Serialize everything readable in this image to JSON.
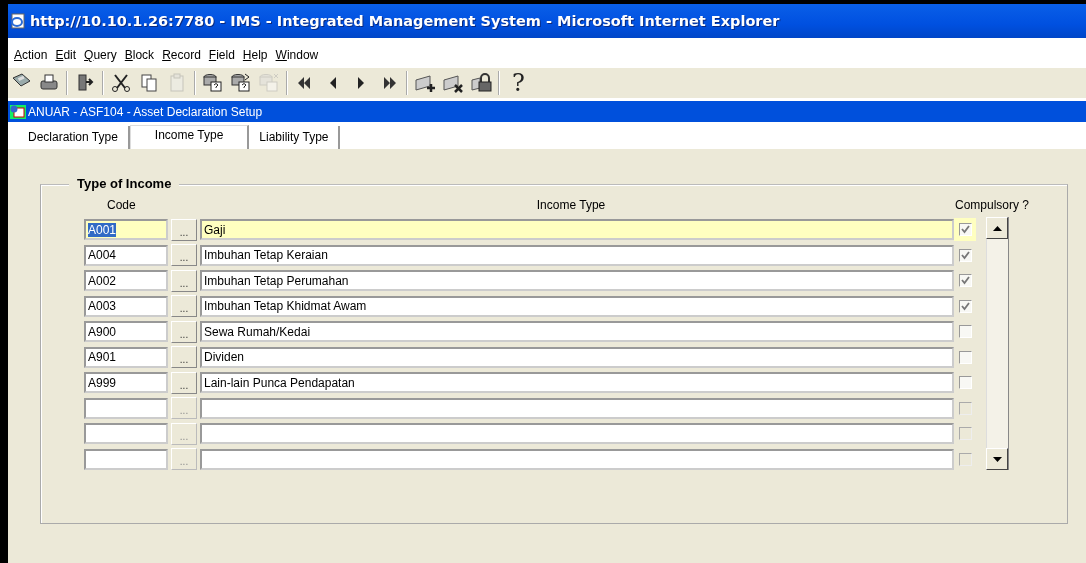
{
  "window": {
    "title": "http://10.10.1.26:7780 - IMS - Integrated Management System - Microsoft Internet Explorer"
  },
  "menu": [
    {
      "label": "Action"
    },
    {
      "label": "Edit"
    },
    {
      "label": "Query"
    },
    {
      "label": "Block"
    },
    {
      "label": "Record"
    },
    {
      "label": "Field"
    },
    {
      "label": "Help"
    },
    {
      "label": "Window"
    }
  ],
  "toolbar": [
    {
      "kind": "save",
      "disabled": false
    },
    {
      "kind": "print",
      "disabled": false
    },
    {
      "kind": "sep"
    },
    {
      "kind": "exit",
      "disabled": false
    },
    {
      "kind": "sep"
    },
    {
      "kind": "cut",
      "disabled": false
    },
    {
      "kind": "copy",
      "disabled": false
    },
    {
      "kind": "paste",
      "disabled": true
    },
    {
      "kind": "sep"
    },
    {
      "kind": "query",
      "disabled": false
    },
    {
      "kind": "query-run",
      "disabled": false
    },
    {
      "kind": "query-cancel",
      "disabled": true
    },
    {
      "kind": "sep"
    },
    {
      "kind": "first",
      "disabled": false
    },
    {
      "kind": "prev",
      "disabled": false
    },
    {
      "kind": "next",
      "disabled": false
    },
    {
      "kind": "last",
      "disabled": false
    },
    {
      "kind": "sep"
    },
    {
      "kind": "insert",
      "disabled": false
    },
    {
      "kind": "delete",
      "disabled": false
    },
    {
      "kind": "lock",
      "disabled": false
    },
    {
      "kind": "sep"
    },
    {
      "kind": "help",
      "label": "?",
      "disabled": false
    }
  ],
  "form": {
    "title": "ANUAR - ASF104 - Asset Declaration Setup"
  },
  "tabs": [
    {
      "label": "Declaration Type",
      "selected": false
    },
    {
      "label": "Income Type",
      "selected": true
    },
    {
      "label": "Liability Type",
      "selected": false
    }
  ],
  "frame": {
    "title": "Type of Income"
  },
  "table": {
    "columns": [
      "Code",
      "Income Type",
      "Compulsory ?"
    ],
    "rows": [
      {
        "code": "A001",
        "lov": "...",
        "income_type": "Gaji",
        "compulsory": true,
        "selected": true,
        "disabled": false
      },
      {
        "code": "A004",
        "lov": "...",
        "income_type": "Imbuhan Tetap Keraian",
        "compulsory": true,
        "selected": false,
        "disabled": false
      },
      {
        "code": "A002",
        "lov": "...",
        "income_type": "Imbuhan Tetap Perumahan",
        "compulsory": true,
        "selected": false,
        "disabled": false
      },
      {
        "code": "A003",
        "lov": "...",
        "income_type": "Imbuhan Tetap Khidmat Awam",
        "compulsory": true,
        "selected": false,
        "disabled": false
      },
      {
        "code": "A900",
        "lov": "...",
        "income_type": "Sewa Rumah/Kedai",
        "compulsory": false,
        "selected": false,
        "disabled": false
      },
      {
        "code": "A901",
        "lov": "...",
        "income_type": "Dividen",
        "compulsory": false,
        "selected": false,
        "disabled": false
      },
      {
        "code": "A999",
        "lov": "...",
        "income_type": "Lain-lain Punca Pendapatan",
        "compulsory": false,
        "selected": false,
        "disabled": false
      },
      {
        "lov": "...",
        "compulsory": false,
        "selected": false,
        "disabled": true
      },
      {
        "lov": "...",
        "compulsory": false,
        "selected": false,
        "disabled": true
      },
      {
        "lov": "...",
        "compulsory": false,
        "selected": false,
        "disabled": true
      }
    ]
  }
}
